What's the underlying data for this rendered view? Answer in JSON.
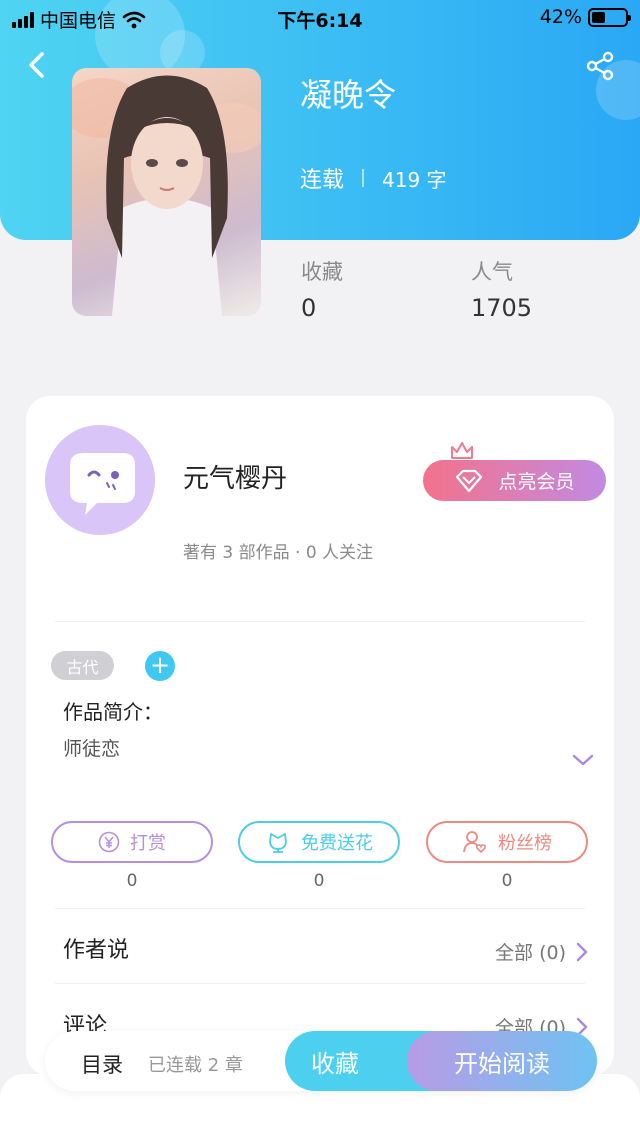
{
  "status_bar": {
    "carrier": "中国电信",
    "time": "下午6:14",
    "battery": "42%",
    "battery_level": 0.42
  },
  "book": {
    "title": "凝晚令",
    "status": "连载",
    "word_count": "419 字",
    "stats": [
      {
        "label": "收藏",
        "value": "0"
      },
      {
        "label": "人气",
        "value": "1705"
      }
    ]
  },
  "author": {
    "name": "元气樱丹",
    "info": "著有 3 部作品 · 0 人关注",
    "vip_label": "点亮会员"
  },
  "tags": [
    "古代"
  ],
  "intro": {
    "title": "作品简介：",
    "text": "师徒恋"
  },
  "actions": [
    {
      "label": "打赏",
      "count": "0",
      "color": "#b48ee0"
    },
    {
      "label": "免费送花",
      "count": "0",
      "color": "#4ccde8"
    },
    {
      "label": "粉丝榜",
      "count": "0",
      "color": "#ec8a82"
    }
  ],
  "sections": [
    {
      "title": "作者说",
      "more": "全部 (0)"
    },
    {
      "title": "评论",
      "more": "全部 (0)"
    }
  ],
  "bottom": {
    "toc": "目录",
    "serial": "已连载 2 章",
    "favorite": "收藏",
    "read": "开始阅读"
  },
  "icons": {
    "back": "back-arrow-icon",
    "share": "share-icon",
    "vip": "diamond-icon",
    "crown": "crown-icon",
    "tip": "yen-icon",
    "flower": "flower-icon",
    "fans": "fans-icon",
    "expand": "chevron-down-icon",
    "more": "chevron-right-icon"
  }
}
